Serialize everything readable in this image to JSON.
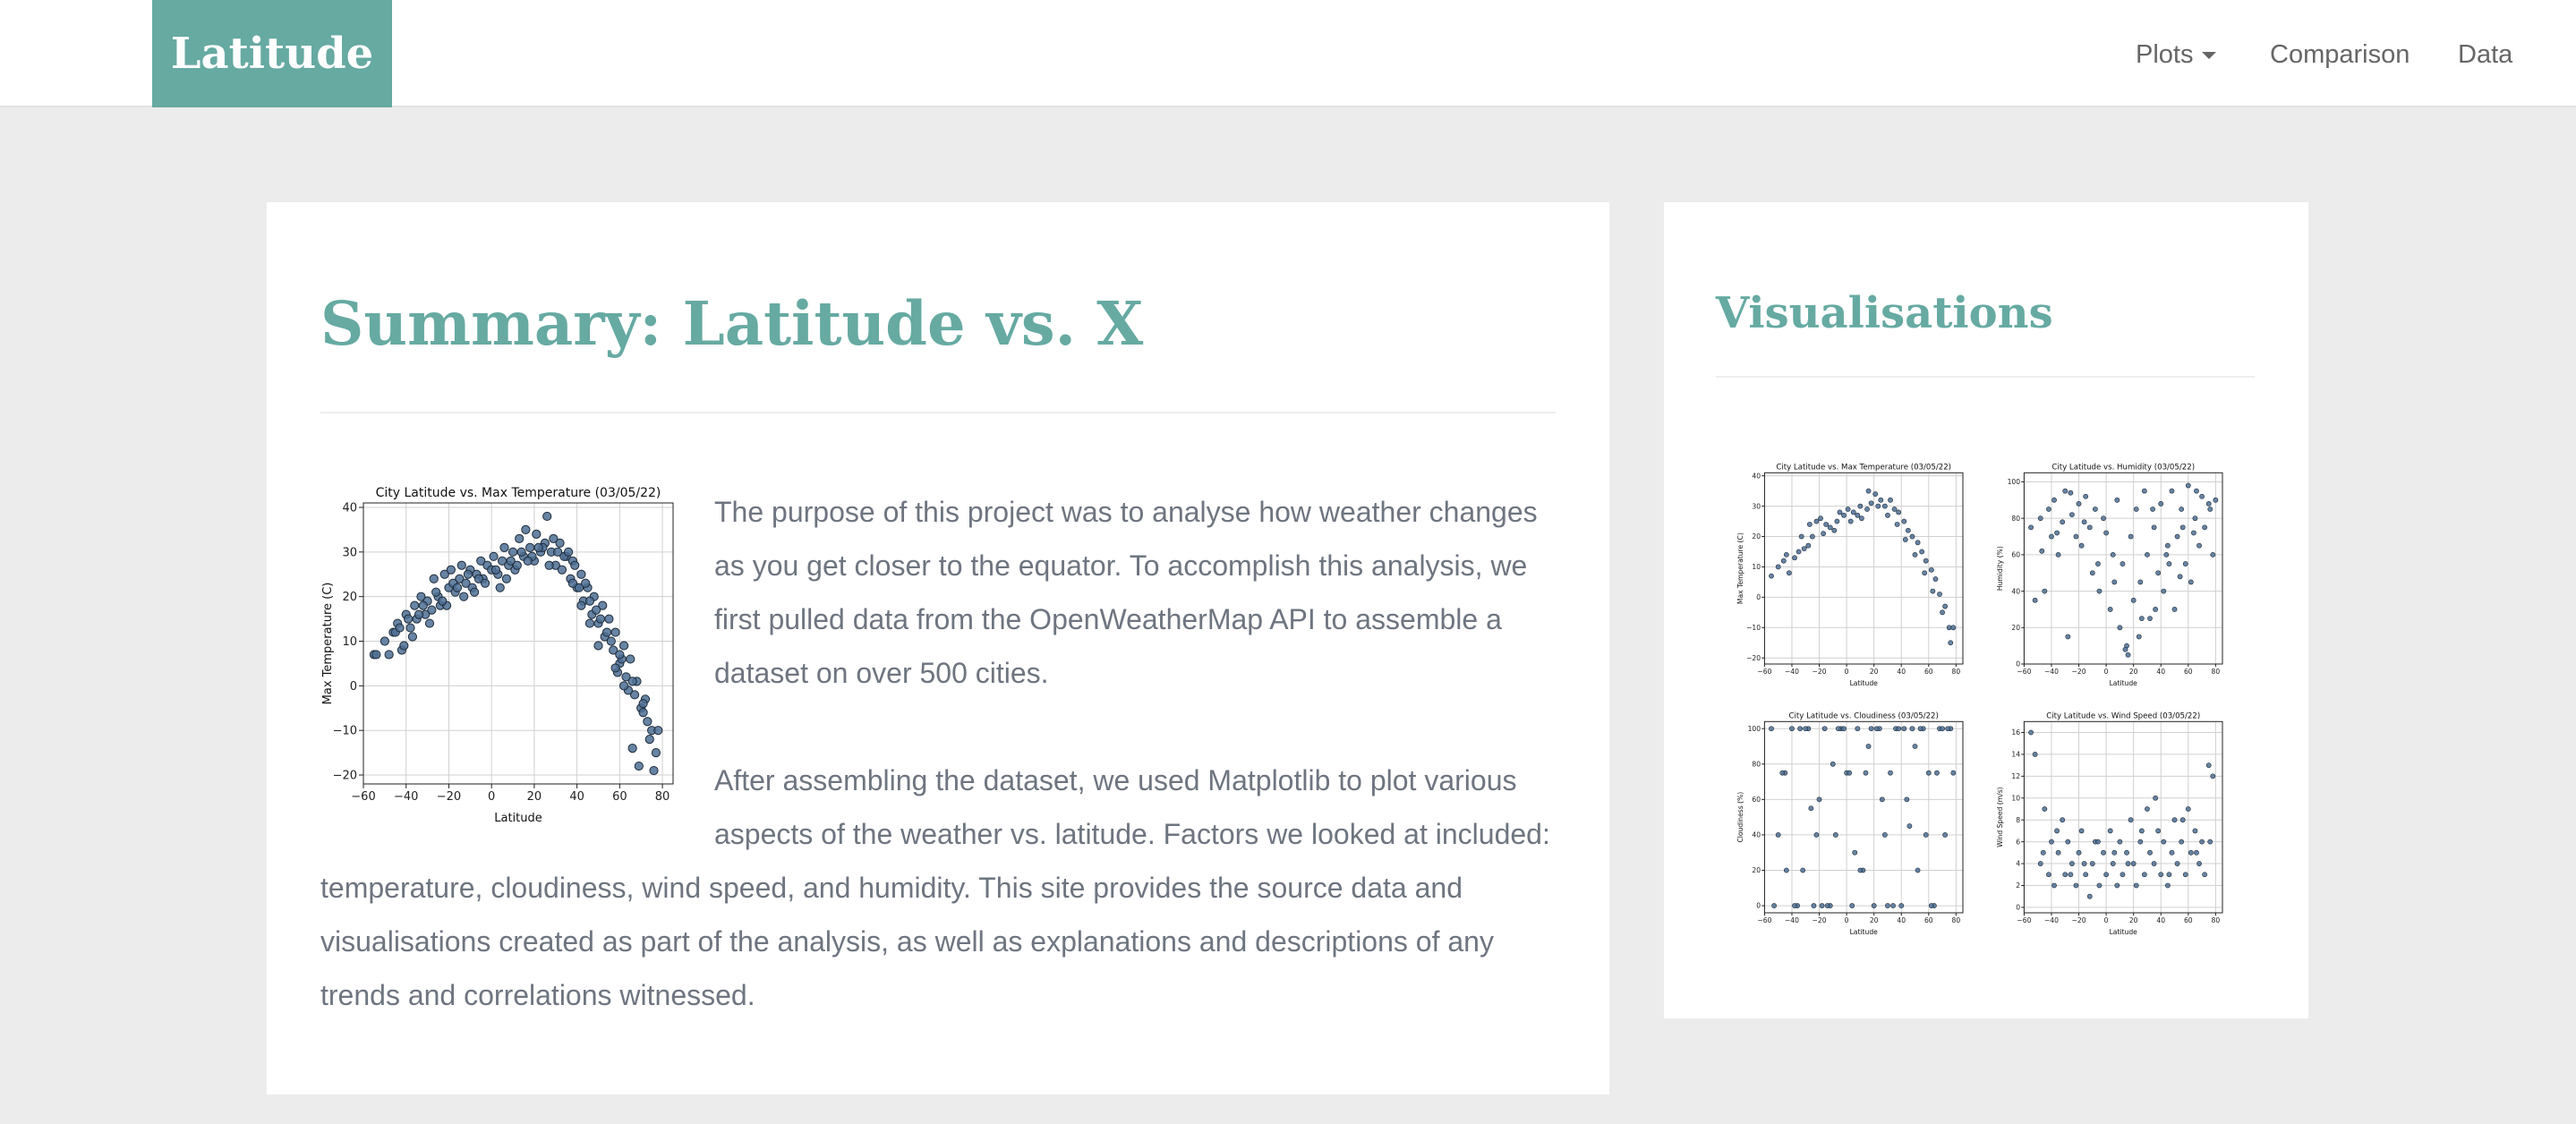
{
  "nav": {
    "brand": "Latitude",
    "plots": "Plots",
    "comparison": "Comparison",
    "data": "Data"
  },
  "summary": {
    "title": "Summary: Latitude vs. X",
    "paragraph1": "The purpose of this project was to analyse how weather changes as you get closer to the equator. To accomplish this analysis, we first pulled data from the OpenWeatherMap API to assemble a dataset on over 500 cities.",
    "paragraph2": "After assembling the dataset, we used Matplotlib to plot various aspects of the weather vs. latitude. Factors we looked at included: temperature, cloudiness, wind speed, and humidity. This site provides the source data and visualisations created as part of the analysis, as well as explanations and descriptions of any trends and correlations witnessed."
  },
  "visualisations": {
    "title": "Visualisations"
  },
  "colors": {
    "accent": "#66aaa2",
    "point_fill": "#4e6f94",
    "point_edge": "#1d2b3a"
  },
  "chart_data": [
    {
      "id": "temp-main",
      "type": "scatter",
      "title": "City Latitude vs. Max Temperature (03/05/22)",
      "xlabel": "Latitude",
      "ylabel": "Max Temperature (C)",
      "xlim": [
        -60,
        85
      ],
      "ylim": [
        -22,
        41
      ],
      "xticks": [
        -60,
        -40,
        -20,
        0,
        20,
        40,
        60,
        80
      ],
      "yticks": [
        -20,
        -10,
        0,
        10,
        20,
        30,
        40
      ],
      "grid": true,
      "x": [
        -55,
        -54,
        -50,
        -48,
        -46,
        -44,
        -42,
        -40,
        -38,
        -36,
        -35,
        -33,
        -31,
        -30,
        -28,
        -27,
        -25,
        -24,
        -22,
        -20,
        -19,
        -17,
        -15,
        -14,
        -12,
        -10,
        -9,
        -7,
        -5,
        -4,
        -2,
        0,
        1,
        3,
        5,
        6,
        8,
        10,
        11,
        13,
        15,
        16,
        18,
        20,
        21,
        23,
        25,
        26,
        28,
        30,
        32,
        33,
        35,
        37,
        38,
        40,
        42,
        43,
        45,
        47,
        48,
        50,
        52,
        53,
        55,
        57,
        58,
        60,
        62,
        63,
        65,
        67,
        68,
        70,
        72,
        73,
        75,
        77,
        78,
        -45,
        -39,
        -32,
        -26,
        -18,
        -11,
        -6,
        2,
        9,
        14,
        19,
        24,
        29,
        34,
        41,
        46,
        51,
        56,
        61,
        66,
        71,
        74,
        64,
        59,
        54,
        49,
        44,
        39,
        36,
        31,
        27,
        22,
        17,
        12,
        7,
        4,
        -3,
        -8,
        -13,
        -16,
        -21,
        -23,
        -29,
        -34,
        -37,
        -41,
        -43,
        69,
        76,
        66,
        62,
        58,
        71,
        60,
        50,
        46,
        38,
        42
      ],
      "y": [
        7,
        7,
        10,
        7,
        12,
        14,
        8,
        16,
        13,
        18,
        15,
        20,
        16,
        19,
        17,
        24,
        20,
        18,
        25,
        22,
        26,
        21,
        24,
        27,
        23,
        26,
        22,
        25,
        28,
        24,
        27,
        26,
        29,
        25,
        28,
        31,
        27,
        30,
        26,
        33,
        29,
        35,
        31,
        28,
        34,
        30,
        32,
        38,
        30,
        27,
        32,
        26,
        29,
        24,
        28,
        22,
        25,
        19,
        22,
        16,
        20,
        14,
        18,
        11,
        15,
        8,
        12,
        5,
        9,
        2,
        6,
        -2,
        1,
        -5,
        -3,
        -8,
        -10,
        -15,
        -10,
        12,
        15,
        18,
        21,
        23,
        25,
        24,
        26,
        28,
        30,
        29,
        31,
        33,
        29,
        22,
        19,
        15,
        10,
        6,
        1,
        -4,
        -12,
        -1,
        3,
        12,
        17,
        23,
        27,
        30,
        30,
        27,
        31,
        28,
        27,
        24,
        22,
        23,
        21,
        20,
        22,
        18,
        19,
        14,
        16,
        11,
        9,
        13,
        -18,
        -19,
        -14,
        0,
        4,
        -6,
        7,
        9,
        14,
        23,
        18
      ]
    },
    {
      "id": "temp-thumb",
      "type": "scatter",
      "title": "City Latitude vs. Max Temperature (03/05/22)",
      "xlabel": "Latitude",
      "ylabel": "Max Temperature (C)",
      "xlim": [
        -60,
        85
      ],
      "ylim": [
        -22,
        41
      ],
      "xticks": [
        -60,
        -40,
        -20,
        0,
        20,
        40,
        60,
        80
      ],
      "yticks": [
        -20,
        -10,
        0,
        10,
        20,
        30,
        40
      ],
      "grid": true,
      "x": [
        -55,
        -50,
        -46,
        -42,
        -38,
        -35,
        -31,
        -28,
        -25,
        -22,
        -19,
        -15,
        -12,
        -9,
        -5,
        -2,
        1,
        5,
        8,
        11,
        15,
        18,
        21,
        25,
        28,
        32,
        35,
        38,
        42,
        45,
        48,
        52,
        55,
        58,
        62,
        65,
        68,
        72,
        75,
        78,
        -44,
        -33,
        -27,
        -17,
        -7,
        3,
        10,
        16,
        23,
        30,
        37,
        43,
        50,
        57,
        63,
        70,
        76
      ],
      "y": [
        7,
        10,
        12,
        8,
        13,
        15,
        16,
        17,
        20,
        25,
        26,
        24,
        23,
        22,
        28,
        27,
        29,
        28,
        27,
        26,
        29,
        31,
        34,
        32,
        30,
        32,
        29,
        28,
        25,
        22,
        20,
        18,
        15,
        12,
        9,
        6,
        1,
        -3,
        -10,
        -10,
        14,
        20,
        24,
        21,
        25,
        25,
        30,
        35,
        30,
        27,
        24,
        19,
        14,
        8,
        2,
        -5,
        -15
      ]
    },
    {
      "id": "humidity-thumb",
      "type": "scatter",
      "title": "City Latitude vs. Humidity (03/05/22)",
      "xlabel": "Latitude",
      "ylabel": "Humidity (%)",
      "xlim": [
        -60,
        85
      ],
      "ylim": [
        0,
        105
      ],
      "xticks": [
        -60,
        -40,
        -20,
        0,
        20,
        40,
        60,
        80
      ],
      "yticks": [
        0,
        20,
        40,
        60,
        80,
        100
      ],
      "grid": true,
      "x": [
        -55,
        -52,
        -48,
        -45,
        -42,
        -40,
        -38,
        -35,
        -32,
        -30,
        -28,
        -25,
        -22,
        -20,
        -18,
        -15,
        -12,
        -10,
        -8,
        -5,
        -2,
        0,
        3,
        5,
        8,
        10,
        12,
        15,
        18,
        20,
        22,
        25,
        28,
        30,
        32,
        35,
        38,
        40,
        42,
        45,
        48,
        50,
        52,
        55,
        58,
        60,
        62,
        65,
        68,
        70,
        72,
        75,
        78,
        80,
        -47,
        -36,
        -26,
        -16,
        -6,
        6,
        16,
        26,
        36,
        46,
        56,
        66,
        76,
        14,
        24,
        34,
        44,
        54,
        64
      ],
      "y": [
        75,
        35,
        80,
        40,
        85,
        70,
        90,
        60,
        78,
        95,
        15,
        82,
        70,
        88,
        65,
        92,
        75,
        50,
        85,
        40,
        80,
        72,
        30,
        60,
        90,
        20,
        55,
        10,
        70,
        35,
        85,
        45,
        95,
        60,
        25,
        75,
        50,
        88,
        40,
        65,
        95,
        30,
        70,
        85,
        55,
        98,
        45,
        80,
        65,
        92,
        75,
        88,
        60,
        90,
        62,
        72,
        94,
        78,
        55,
        45,
        5,
        25,
        30,
        55,
        75,
        95,
        85,
        8,
        15,
        85,
        60,
        48,
        72
      ]
    },
    {
      "id": "cloudiness-thumb",
      "type": "scatter",
      "title": "City Latitude vs. Cloudiness (03/05/22)",
      "xlabel": "Latitude",
      "ylabel": "Cloudiness (%)",
      "xlim": [
        -60,
        85
      ],
      "ylim": [
        -4,
        104
      ],
      "xticks": [
        -60,
        -40,
        -20,
        0,
        20,
        40,
        60,
        80
      ],
      "yticks": [
        0,
        20,
        40,
        60,
        80,
        100
      ],
      "grid": true,
      "x": [
        -55,
        -50,
        -45,
        -40,
        -36,
        -32,
        -28,
        -24,
        -20,
        -16,
        -12,
        -8,
        -4,
        0,
        4,
        8,
        12,
        16,
        20,
        24,
        28,
        32,
        36,
        40,
        44,
        48,
        52,
        56,
        60,
        64,
        68,
        72,
        76,
        -53,
        -47,
        -38,
        -30,
        -22,
        -14,
        -6,
        2,
        10,
        18,
        26,
        34,
        42,
        50,
        58,
        66,
        74,
        -44,
        -34,
        -26,
        -18,
        -10,
        -2,
        6,
        14,
        22,
        30,
        38,
        46,
        54,
        62,
        70,
        78
      ],
      "y": [
        100,
        40,
        75,
        100,
        0,
        20,
        100,
        0,
        60,
        100,
        0,
        40,
        100,
        75,
        0,
        100,
        20,
        90,
        0,
        100,
        40,
        75,
        100,
        0,
        60,
        100,
        20,
        100,
        75,
        0,
        100,
        40,
        100,
        0,
        75,
        0,
        100,
        40,
        0,
        100,
        75,
        20,
        100,
        60,
        0,
        100,
        90,
        40,
        75,
        100,
        20,
        100,
        55,
        0,
        80,
        100,
        30,
        75,
        100,
        0,
        100,
        45,
        100,
        0,
        100,
        75
      ]
    },
    {
      "id": "wind-thumb",
      "type": "scatter",
      "title": "City Latitude vs. Wind Speed (03/05/22)",
      "xlabel": "Latitude",
      "ylabel": "Wind Speed (m/s)",
      "xlim": [
        -60,
        85
      ],
      "ylim": [
        -0.5,
        17
      ],
      "xticks": [
        -60,
        -40,
        -20,
        0,
        20,
        40,
        60,
        80
      ],
      "yticks": [
        0,
        2,
        4,
        6,
        8,
        10,
        12,
        14,
        16
      ],
      "grid": true,
      "x": [
        -55,
        -52,
        -48,
        -45,
        -42,
        -40,
        -38,
        -35,
        -32,
        -30,
        -28,
        -25,
        -22,
        -20,
        -18,
        -15,
        -12,
        -10,
        -8,
        -5,
        -2,
        0,
        3,
        5,
        8,
        10,
        12,
        15,
        18,
        20,
        22,
        25,
        28,
        30,
        32,
        35,
        38,
        40,
        42,
        45,
        48,
        50,
        52,
        55,
        58,
        60,
        62,
        65,
        68,
        70,
        72,
        75,
        78,
        -46,
        -36,
        -26,
        -16,
        -6,
        6,
        16,
        26,
        36,
        46,
        56,
        66,
        76
      ],
      "y": [
        16,
        14,
        4,
        9,
        3,
        6,
        2,
        5,
        8,
        3,
        6,
        4,
        2,
        5,
        7,
        3,
        1,
        4,
        6,
        2,
        5,
        3,
        7,
        4,
        2,
        6,
        3,
        5,
        8,
        4,
        2,
        6,
        3,
        9,
        5,
        4,
        7,
        3,
        6,
        2,
        5,
        8,
        4,
        6,
        3,
        9,
        5,
        7,
        4,
        6,
        3,
        13,
        12,
        5,
        7,
        3,
        4,
        6,
        5,
        4,
        7,
        10,
        3,
        8,
        5,
        6
      ]
    }
  ]
}
